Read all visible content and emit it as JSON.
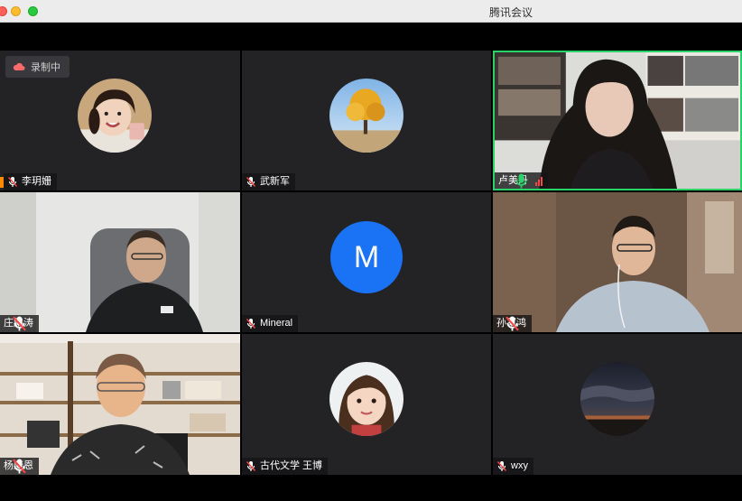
{
  "window": {
    "title": "腾讯会议"
  },
  "recording": {
    "label": "录制中"
  },
  "participants": [
    {
      "name": "李玥姗",
      "avatar": "child-girl-avatar",
      "muted": true
    },
    {
      "name": "武新军",
      "avatar": "autumn-tree-avatar",
      "muted": true
    },
    {
      "name": "卢美丹",
      "video": "woman-speaking-video",
      "muted": false,
      "speaking": true
    },
    {
      "name": "庄鹏涛",
      "video": "man-in-chair-video",
      "muted": true
    },
    {
      "name": "Mineral",
      "avatar_letter": "M",
      "muted": true
    },
    {
      "name": "孙军鸿",
      "video": "man-with-earphones-video",
      "muted": true
    },
    {
      "name": "杨康恩",
      "video": "man-with-glasses-video",
      "muted": true
    },
    {
      "name": "古代文学 王博",
      "avatar": "child-girl-avatar-2",
      "muted": true
    },
    {
      "name": "wxy",
      "avatar": "night-sky-avatar",
      "muted": true
    }
  ],
  "colors": {
    "active_border": "#2ad36a",
    "mic_on": "#2ad36a",
    "mic_muted": "#ffffff",
    "tile_bg": "#232326",
    "avatar_letter_bg": "#1a73f5"
  }
}
